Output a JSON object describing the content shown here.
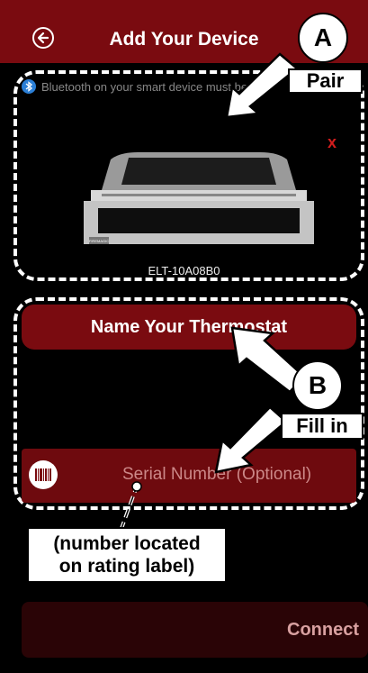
{
  "header": {
    "title": "Add Your Device",
    "back_icon": "arrow-left-circle-icon",
    "background": "#7a0b10"
  },
  "device": {
    "bluetooth_note": "Bluetooth on your smart device must be a",
    "close_symbol": "x",
    "model": "ELT-10A08B0",
    "grill_badge": "FIREMAGIC"
  },
  "form": {
    "name_button": "Name Your Thermostat",
    "serial_placeholder": "Serial Number (Optional)",
    "connect_button": "Connect"
  },
  "annotations": {
    "a_letter": "A",
    "a_label": "Pair",
    "b_letter": "B",
    "b_label": "Fill in",
    "note_line1": "(number located",
    "note_line2": "on rating label)"
  }
}
